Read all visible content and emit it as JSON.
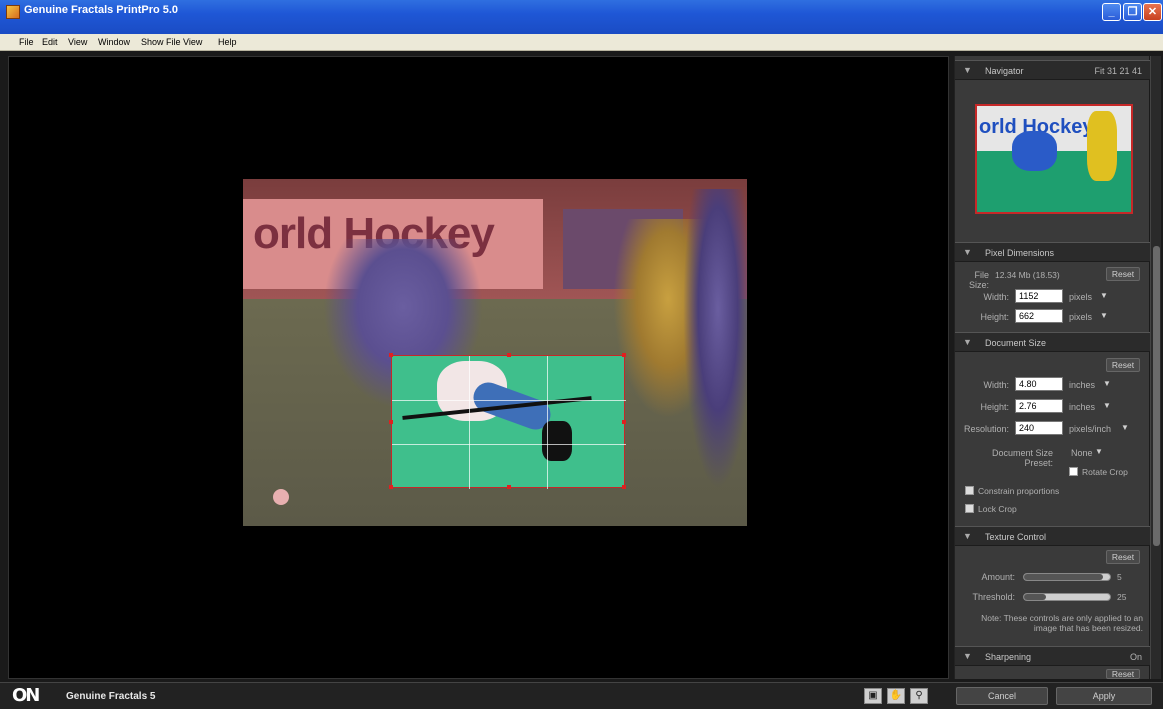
{
  "window": {
    "title": "Genuine Fractals PrintPro 5.0",
    "minimize": "_",
    "restore": "❒",
    "close": "✕"
  },
  "menu": [
    "File",
    "Edit",
    "View",
    "Window",
    "Show File View",
    "Help"
  ],
  "photo": {
    "banner_text": "orld Hockey"
  },
  "navigator": {
    "title": "Navigator",
    "zoom": "Fit 31 21 41",
    "thumb_text": "orld Hockey"
  },
  "pixel_dimensions": {
    "title": "Pixel Dimensions",
    "file_size_label": "File Size:",
    "file_size_value": "12.34 Mb (18.53)",
    "reset": "Reset",
    "width_label": "Width:",
    "width_value": "1152",
    "width_unit": "pixels",
    "height_label": "Height:",
    "height_value": "662",
    "height_unit": "pixels"
  },
  "document_size": {
    "title": "Document Size",
    "reset": "Reset",
    "width_label": "Width:",
    "width_value": "4.80",
    "width_unit": "inches",
    "height_label": "Height:",
    "height_value": "2.76",
    "height_unit": "inches",
    "resolution_label": "Resolution:",
    "resolution_value": "240",
    "resolution_unit": "pixels/inch",
    "preset_label": "Document Size Preset:",
    "preset_value": "None",
    "rotate_label": "Rotate Crop",
    "constrain_label": "Constrain proportions",
    "lock_crop_label": "Lock Crop"
  },
  "texture_control": {
    "title": "Texture Control",
    "reset": "Reset",
    "amount_label": "Amount:",
    "amount_value": "5",
    "threshold_label": "Threshold:",
    "threshold_value": "25",
    "note": "Note: These controls are only applied to an image that has been resized."
  },
  "sharpening": {
    "title": "Sharpening",
    "toggle": "On",
    "reset": "Reset"
  },
  "bottom": {
    "logo_mark": "ON",
    "app_name": "Genuine Fractals 5",
    "cancel": "Cancel",
    "apply": "Apply",
    "tool_icons": [
      "crop-tool-icon",
      "hand-tool-icon",
      "zoom-tool-icon"
    ]
  },
  "colors": {
    "title_bar": "#1f57d6",
    "crop_overlay": "#3fbf8c",
    "crop_border": "#c62828",
    "panel": "#3a3a3a"
  },
  "sliders": {
    "amount": 0.92,
    "threshold": 0.25
  }
}
